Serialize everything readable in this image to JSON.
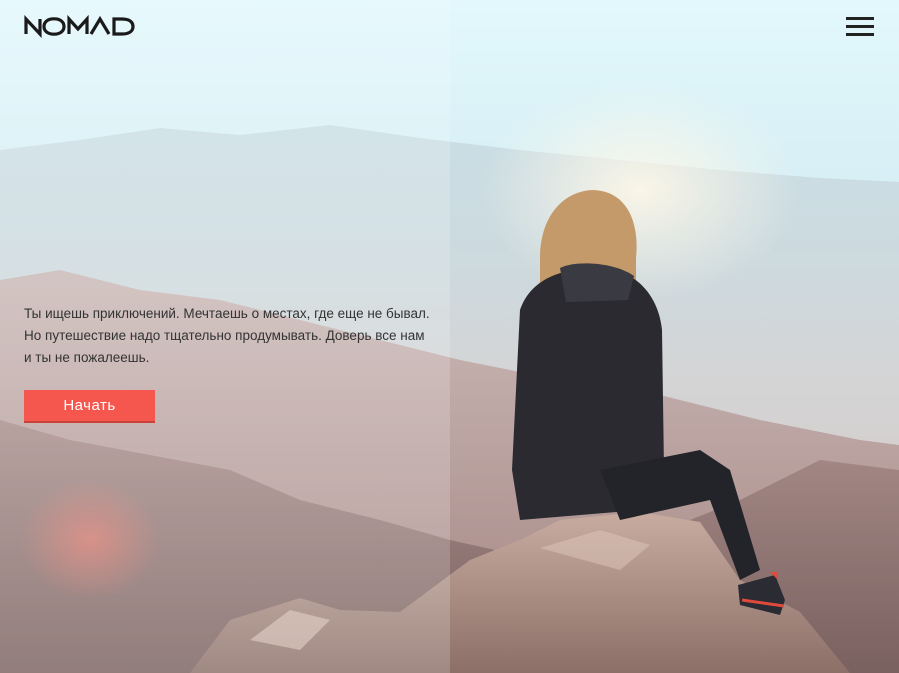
{
  "brand": {
    "logo_text": "NOMAD"
  },
  "header": {
    "menu_icon": "hamburger-icon"
  },
  "hero": {
    "description": "Ты ищешь приключений. Мечтаешь о местах, где еще не бывал. Но путешествие надо тщательно продумывать. Доверь все нам и ты не пожалеешь.",
    "cta_label": "Начать"
  },
  "colors": {
    "accent": "#f5574e",
    "text": "#333333",
    "logo": "#1a1a1a"
  }
}
